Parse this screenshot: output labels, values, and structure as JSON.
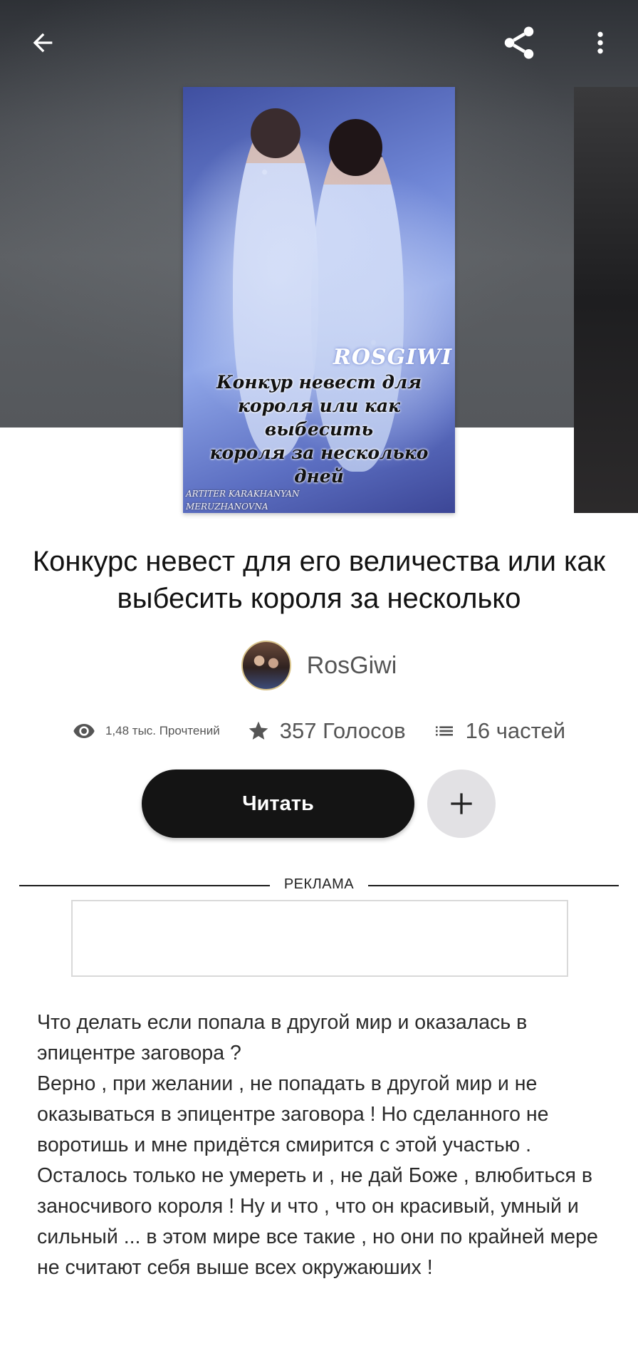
{
  "cover": {
    "brand_text": "ROSGIWI",
    "title_lines": "Конкур невест для\nкороля или как выбесить\nкороля за несколько дней",
    "credit_lines": "ARTITER KARAKHANYAN\nMERUZHANOVNA"
  },
  "book": {
    "title": "Конкурс невест для его величества или как выбесить короля за несколько"
  },
  "author": {
    "name": "RosGiwi"
  },
  "stats": {
    "reads": "1,48 тыс. Прочтений",
    "votes": "357 Голосов",
    "parts": "16 частей"
  },
  "actions": {
    "read_label": "Читать"
  },
  "ad": {
    "label": "РЕКЛАМА"
  },
  "description": "Что делать если попала в другой мир и оказалась в эпицентре заговора ?\nВерно , при желании , не попадать в другой мир и не оказываться в эпицентре заговора ! Но сделанного не воротишь и мне придётся смирится с этой участью . Осталось только не умереть и , не дай Боже , влюбиться в заносчивого короля ! Ну и что , что он красивый,  умный  и сильный ... в этом мире все такие , но они по крайней мере не считают себя выше всех окружаюших !",
  "icons": {
    "back": "arrow-left-icon",
    "share": "share-icon",
    "more": "more-vertical-icon",
    "reads": "eye-icon",
    "votes": "star-icon",
    "parts": "list-icon",
    "add": "plus-icon"
  },
  "colors": {
    "read_button_bg": "#141414",
    "add_button_bg": "#e2e1e4",
    "text_primary": "#121212",
    "text_secondary": "#555555"
  }
}
